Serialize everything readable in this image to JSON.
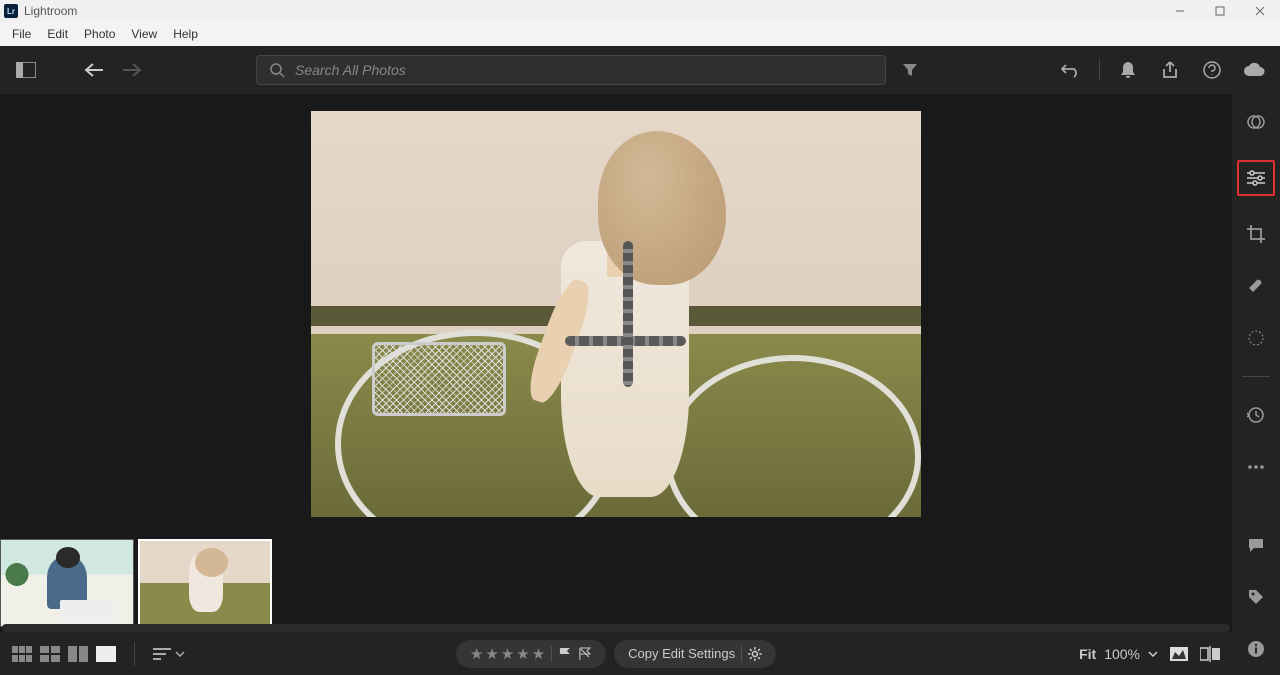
{
  "app": {
    "title": "Lightroom"
  },
  "menubar": {
    "items": [
      "File",
      "Edit",
      "Photo",
      "View",
      "Help"
    ]
  },
  "toolbar": {
    "search_placeholder": "Search All Photos"
  },
  "right_panel": {
    "tools": [
      {
        "name": "presets",
        "highlighted": false
      },
      {
        "name": "edit-sliders",
        "highlighted": true
      },
      {
        "name": "crop",
        "highlighted": false
      },
      {
        "name": "healing",
        "highlighted": false
      },
      {
        "name": "masking",
        "highlighted": false
      }
    ],
    "history": "versions",
    "more": "more",
    "lower": [
      "comments",
      "keywords",
      "info"
    ]
  },
  "filmstrip": {
    "thumbs": [
      {
        "id": "thumb-1",
        "selected": false
      },
      {
        "id": "thumb-2",
        "selected": true
      }
    ]
  },
  "bottombar": {
    "copy_settings_label": "Copy Edit Settings",
    "zoom_fit_label": "Fit",
    "zoom_percent": "100%",
    "star_count": 5
  }
}
